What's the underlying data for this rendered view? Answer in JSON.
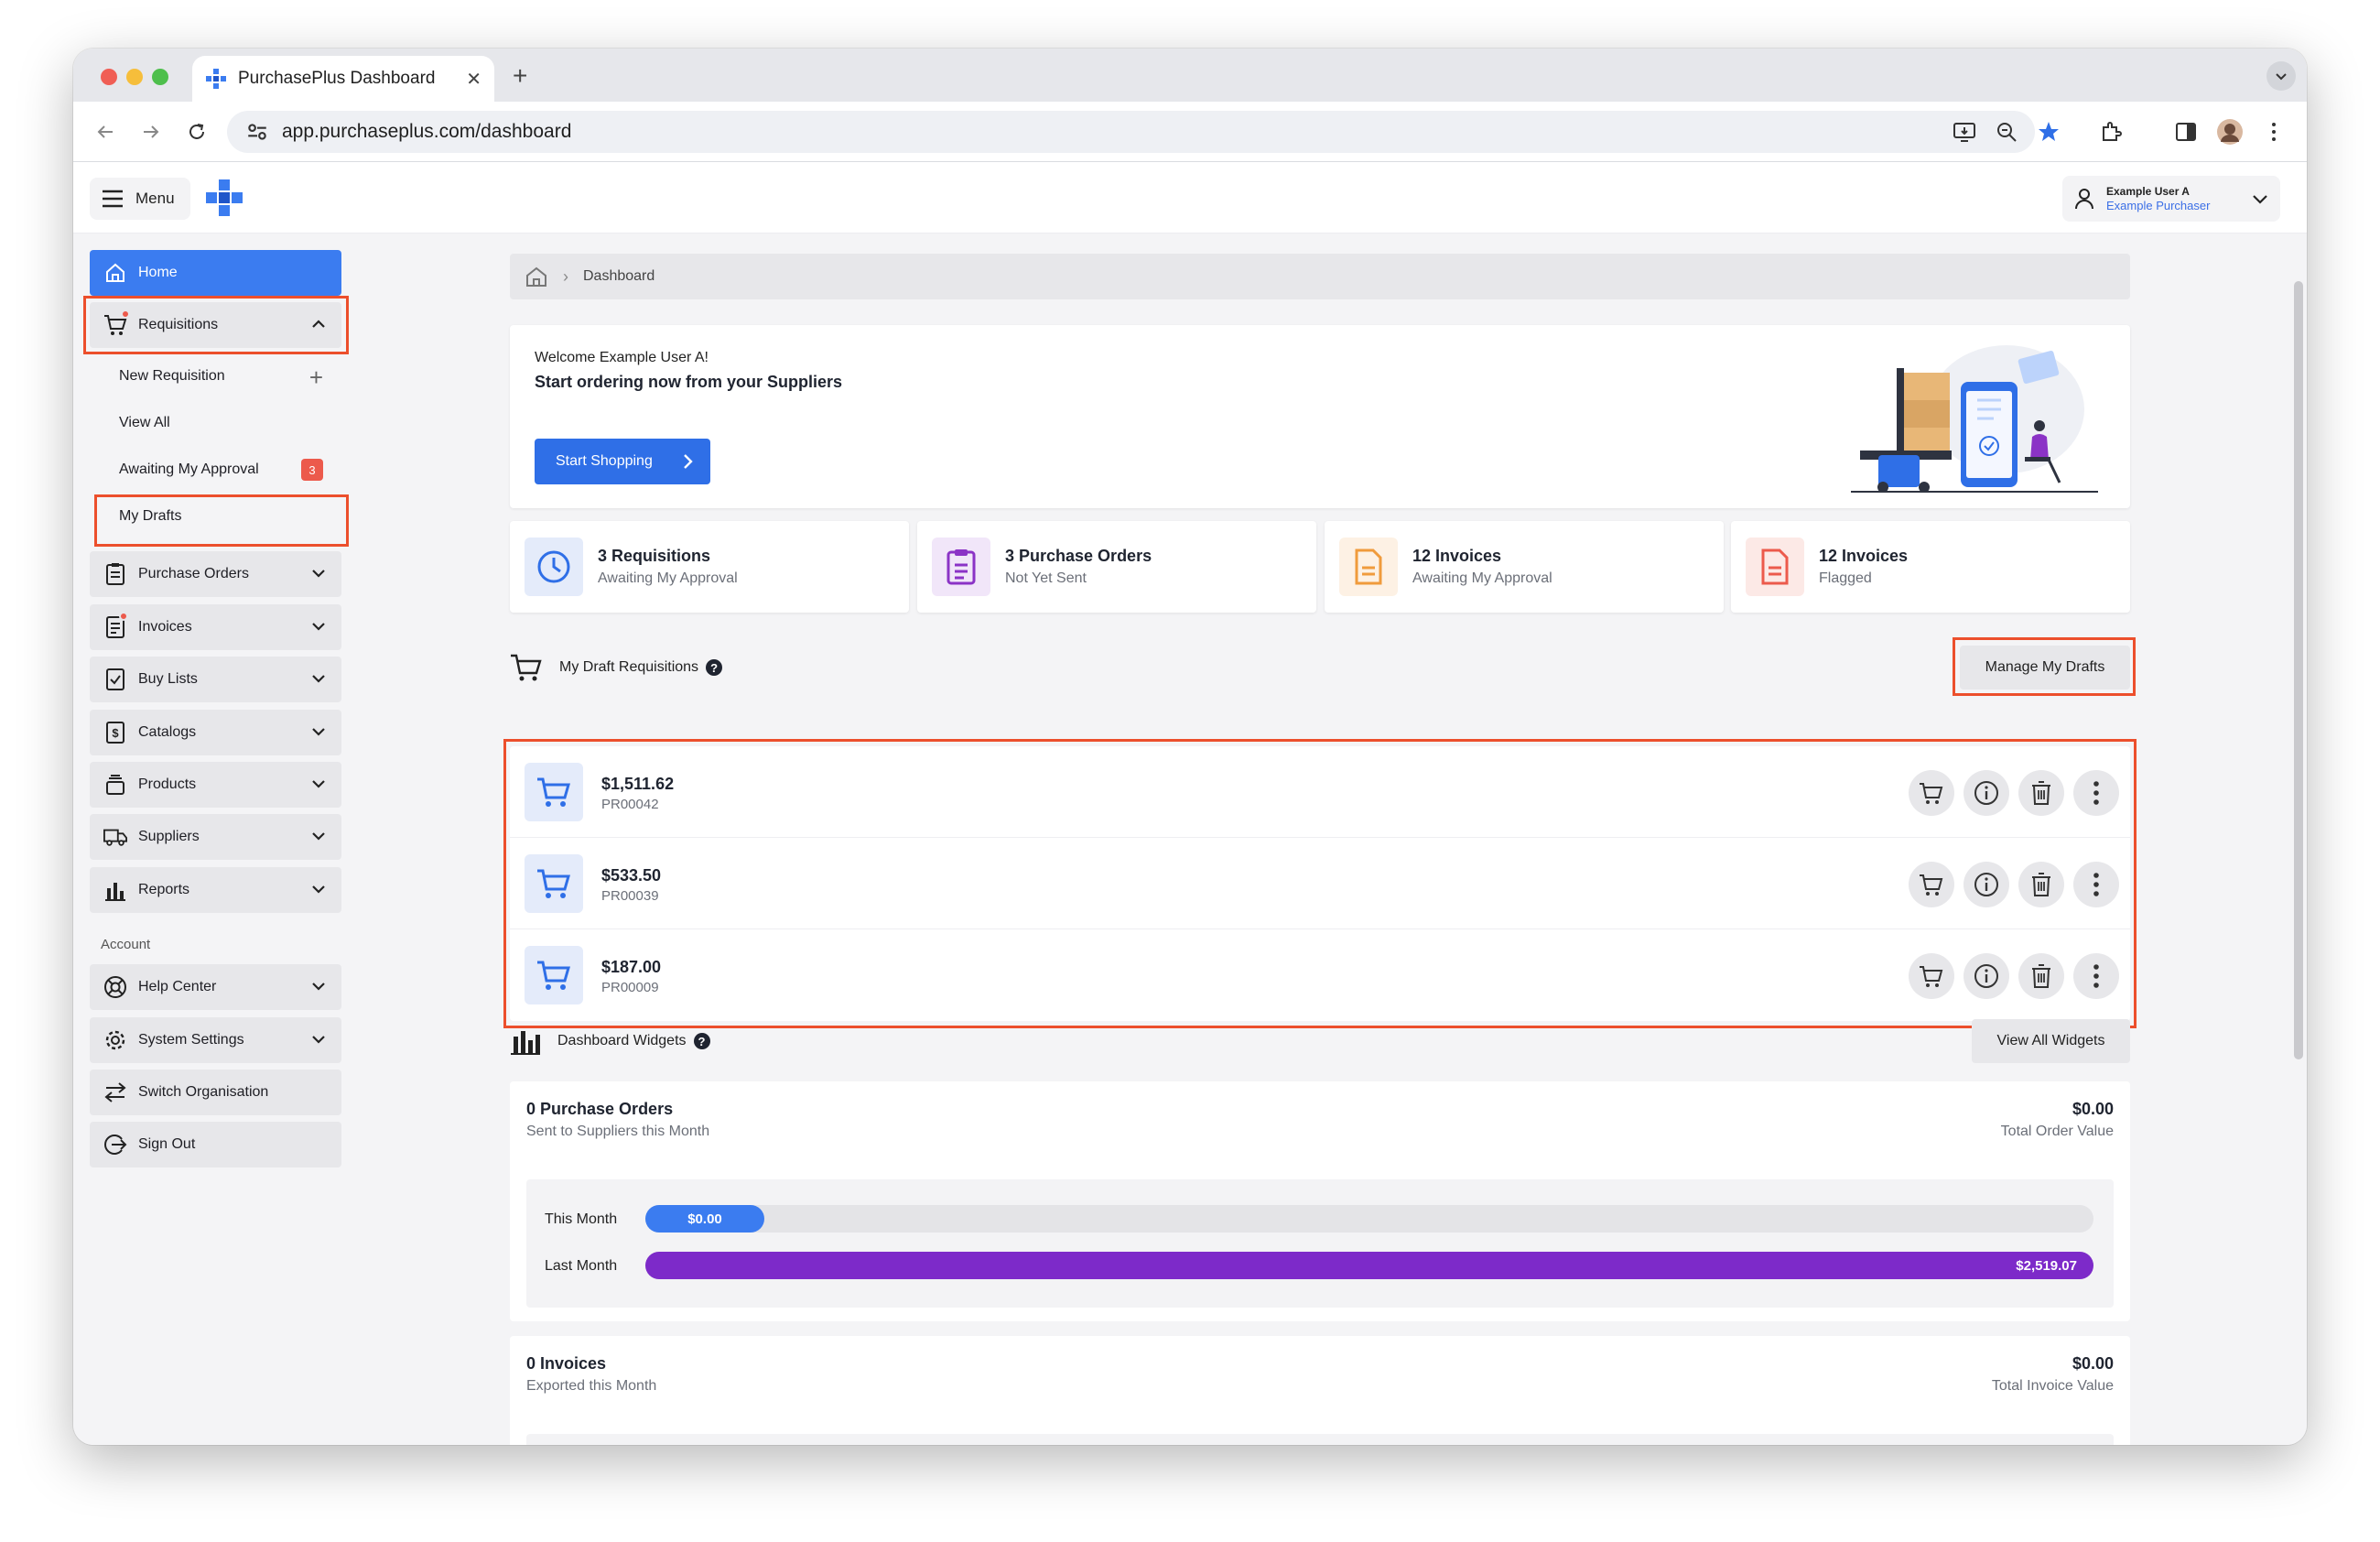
{
  "browser": {
    "tab_title": "PurchasePlus Dashboard",
    "close_glyph": "✕",
    "new_tab_glyph": "+",
    "url": "app.purchaseplus.com/dashboard"
  },
  "header": {
    "menu_label": "Menu",
    "user_name": "Example User A",
    "user_role": "Example Purchaser"
  },
  "sidebar": {
    "home": "Home",
    "requisitions": "Requisitions",
    "sub": {
      "new_requisition": "New Requisition",
      "view_all": "View All",
      "awaiting_my_approval": "Awaiting My Approval",
      "awaiting_badge": "3",
      "my_drafts": "My Drafts"
    },
    "items": [
      "Purchase Orders",
      "Invoices",
      "Buy Lists",
      "Catalogs",
      "Products",
      "Suppliers",
      "Reports"
    ],
    "account_heading": "Account",
    "account_items": [
      "Help Center",
      "System Settings",
      "Switch Organisation",
      "Sign Out"
    ]
  },
  "breadcrumb": {
    "current": "Dashboard"
  },
  "welcome": {
    "greeting": "Welcome Example User A!",
    "subtitle": "Start ordering now from your Suppliers",
    "button": "Start Shopping"
  },
  "stats": [
    {
      "title": "3 Requisitions",
      "sub": "Awaiting My Approval"
    },
    {
      "title": "3 Purchase Orders",
      "sub": "Not Yet Sent"
    },
    {
      "title": "12 Invoices",
      "sub": "Awaiting My Approval"
    },
    {
      "title": "12 Invoices",
      "sub": "Flagged"
    }
  ],
  "drafts": {
    "heading": "My Draft Requisitions",
    "help": "?",
    "manage_button": "Manage My Drafts",
    "rows": [
      {
        "amount": "$1,511.62",
        "id": "PR00042"
      },
      {
        "amount": "$533.50",
        "id": "PR00039"
      },
      {
        "amount": "$187.00",
        "id": "PR00009"
      }
    ]
  },
  "widgets": {
    "heading": "Dashboard Widgets",
    "help": "?",
    "view_all_button": "View All Widgets",
    "purchase_orders": {
      "title": "0 Purchase Orders",
      "sub": "Sent to Suppliers this Month",
      "value": "$0.00",
      "value_sub": "Total Order Value",
      "this_month_label": "This Month",
      "this_month_value": "$0.00",
      "last_month_label": "Last Month",
      "last_month_value": "$2,519.07",
      "this_month_fraction": 0.0,
      "last_month_fraction": 1.0
    },
    "invoices": {
      "title": "0 Invoices",
      "sub": "Exported this Month",
      "value": "$0.00",
      "value_sub": "Total Invoice Value"
    }
  },
  "colors": {
    "primary": "#3b7cf0",
    "highlight": "#ec4f2c",
    "purple_bar": "#7d2ac9",
    "badge_red": "#ec5a4c"
  }
}
